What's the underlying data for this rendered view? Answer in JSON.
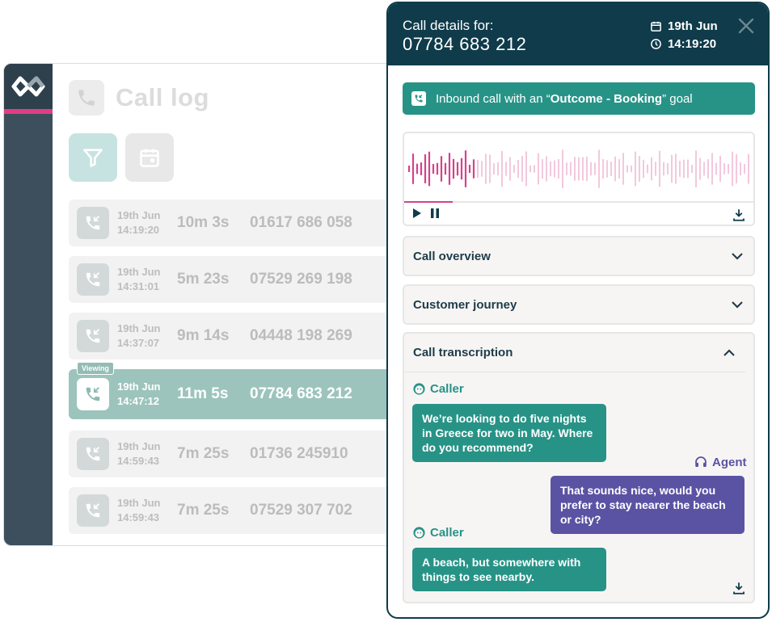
{
  "app": {
    "title": "Call log",
    "rows": [
      {
        "date": "19th Jun",
        "time": "14:19:20",
        "duration": "10m 3s",
        "number": "01617 686 058"
      },
      {
        "date": "19th Jun",
        "time": "14:31:01",
        "duration": "5m 23s",
        "number": "07529 269 198"
      },
      {
        "date": "19th Jun",
        "time": "14:37:07",
        "duration": "9m 14s",
        "number": "04448 198 269"
      },
      {
        "date": "19th Jun",
        "time": "14:47:12",
        "duration": "11m 5s",
        "number": "07784 683 212",
        "badge": "Viewing"
      },
      {
        "date": "19th Jun",
        "time": "14:59:43",
        "duration": "7m 25s",
        "number": "01736 245910"
      },
      {
        "date": "19th Jun",
        "time": "14:59:43",
        "duration": "7m 25s",
        "number": "07529 307 702"
      }
    ]
  },
  "panel": {
    "label": "Call details for:",
    "phone": "07784 683 212",
    "date": "19th Jun",
    "time": "14:19:20",
    "goal": {
      "prefix": "Inbound call with an “",
      "bold": "Outcome - Booking",
      "suffix": "” goal"
    },
    "player": {
      "progress": 0.14
    },
    "sections": {
      "overview": "Call overview",
      "journey": "Customer journey",
      "transcription": "Call transcription"
    },
    "transcript": [
      {
        "speaker": "Caller",
        "text": "We’re looking to do five nights in Greece for two in May. Where do you recommend?"
      },
      {
        "speaker": "Agent",
        "text": "That sounds nice, would you prefer to stay nearer the beach or city?"
      },
      {
        "speaker": "Caller",
        "text": "A beach, but somewhere with things to see nearby."
      }
    ]
  },
  "colors": {
    "navy": "#0f3b4a",
    "teal": "#279386",
    "purple": "#5a53a3",
    "pink": "#d5438a",
    "sidebar": "#3d4f5d"
  },
  "icons": [
    "logo-icon",
    "phone-icon",
    "filter-icon",
    "calendar-icon",
    "incoming-call-icon",
    "clock-icon",
    "close-icon",
    "play-icon",
    "pause-icon",
    "download-icon",
    "chevron-down-icon",
    "chevron-up-icon",
    "caller-face-icon",
    "headset-icon"
  ]
}
